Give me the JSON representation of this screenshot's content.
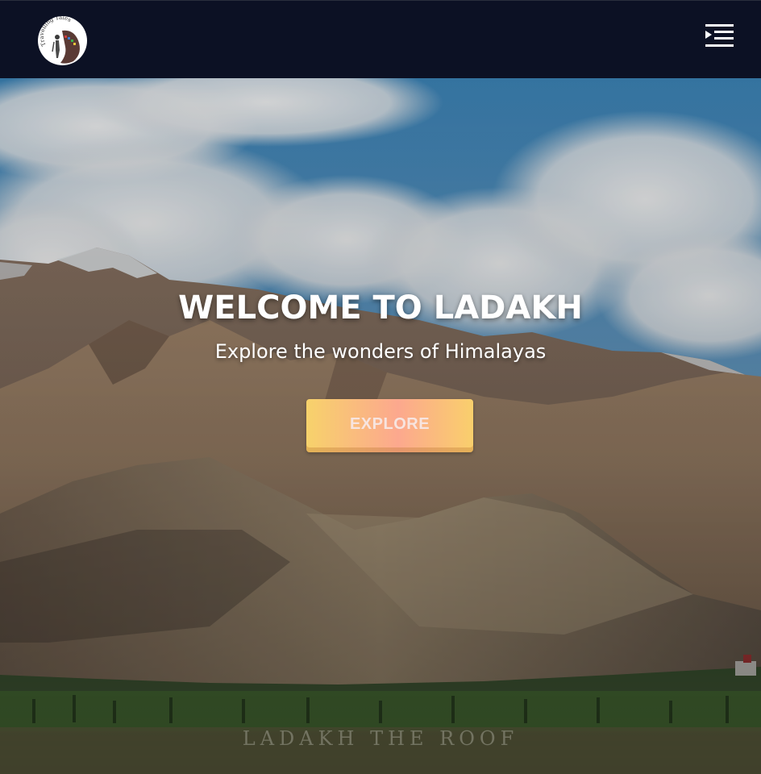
{
  "header": {
    "logo_text": "Travelling Tales",
    "menu_icon": "menu-indent-icon"
  },
  "hero": {
    "title": "WELCOME TO LADAKH",
    "subtitle": "Explore the wonders of Himalayas",
    "cta_label": "EXPLORE",
    "watermark": "LADAKH THE ROOF"
  },
  "colors": {
    "navbar_bg": "#0c1124",
    "cta_gradient_start": "#f7d26b",
    "cta_gradient_mid": "#fca88e",
    "title_text": "#ffffff"
  }
}
